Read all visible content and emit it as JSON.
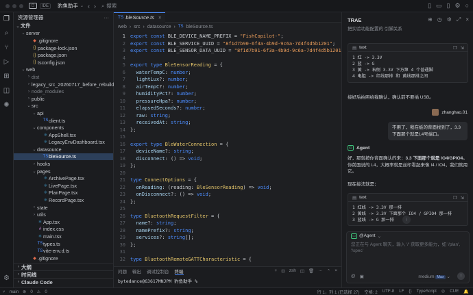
{
  "titlebar": {
    "app_badge": "IDE",
    "project": "豹鱼助手",
    "search_placeholder": "搜索"
  },
  "sidebar": {
    "title": "资源管理器",
    "rows": [
      {
        "d": 0,
        "tw": "⌄",
        "icon": "",
        "label": "文件",
        "kind": "section"
      },
      {
        "d": 1,
        "tw": "⌄",
        "icon": "",
        "label": "server",
        "kind": "folder"
      },
      {
        "d": 2,
        "tw": "",
        "icon": "◆",
        "label": ".gitignore",
        "kind": "git"
      },
      {
        "d": 2,
        "tw": "",
        "icon": "{}",
        "label": "package-lock.json",
        "kind": "json"
      },
      {
        "d": 2,
        "tw": "",
        "icon": "{}",
        "label": "package.json",
        "kind": "json"
      },
      {
        "d": 2,
        "tw": "",
        "icon": "{}",
        "label": "tsconfig.json",
        "kind": "json"
      },
      {
        "d": 1,
        "tw": "⌄",
        "icon": "",
        "label": "web",
        "kind": "folder"
      },
      {
        "d": 2,
        "tw": "›",
        "icon": "",
        "label": "dist",
        "kind": "folder-dim"
      },
      {
        "d": 2,
        "tw": "›",
        "icon": "",
        "label": "legacy_src_20260717_before_rebuild",
        "kind": "folder"
      },
      {
        "d": 2,
        "tw": "›",
        "icon": "",
        "label": "node_modules",
        "kind": "folder-dim"
      },
      {
        "d": 2,
        "tw": "›",
        "icon": "",
        "label": "public",
        "kind": "folder"
      },
      {
        "d": 2,
        "tw": "⌄",
        "icon": "",
        "label": "src",
        "kind": "folder"
      },
      {
        "d": 3,
        "tw": "⌄",
        "icon": "",
        "label": "api",
        "kind": "folder"
      },
      {
        "d": 4,
        "tw": "",
        "icon": "TS",
        "label": "client.ts",
        "kind": "ts"
      },
      {
        "d": 3,
        "tw": "⌄",
        "icon": "",
        "label": "components",
        "kind": "folder"
      },
      {
        "d": 4,
        "tw": "",
        "icon": "⚛",
        "label": "AppShell.tsx",
        "kind": "tsx"
      },
      {
        "d": 4,
        "tw": "",
        "icon": "⚛",
        "label": "LegacyEnvDashboard.tsx",
        "kind": "tsx"
      },
      {
        "d": 3,
        "tw": "⌄",
        "icon": "",
        "label": "datasource",
        "kind": "folder"
      },
      {
        "d": 4,
        "tw": "",
        "icon": "TS",
        "label": "bleSource.ts",
        "kind": "ts",
        "selected": true
      },
      {
        "d": 3,
        "tw": "›",
        "icon": "",
        "label": "hooks",
        "kind": "folder"
      },
      {
        "d": 3,
        "tw": "⌄",
        "icon": "",
        "label": "pages",
        "kind": "folder"
      },
      {
        "d": 4,
        "tw": "",
        "icon": "⚛",
        "label": "ArchivePage.tsx",
        "kind": "tsx"
      },
      {
        "d": 4,
        "tw": "",
        "icon": "⚛",
        "label": "LivePage.tsx",
        "kind": "tsx"
      },
      {
        "d": 4,
        "tw": "",
        "icon": "⚛",
        "label": "PlanPage.tsx",
        "kind": "tsx"
      },
      {
        "d": 4,
        "tw": "",
        "icon": "⚛",
        "label": "RecordPage.tsx",
        "kind": "tsx"
      },
      {
        "d": 3,
        "tw": "›",
        "icon": "",
        "label": "state",
        "kind": "folder"
      },
      {
        "d": 3,
        "tw": "›",
        "icon": "",
        "label": "utils",
        "kind": "folder"
      },
      {
        "d": 3,
        "tw": "",
        "icon": "⚛",
        "label": "App.tsx",
        "kind": "tsx"
      },
      {
        "d": 3,
        "tw": "",
        "icon": "#",
        "label": "index.css",
        "kind": "css"
      },
      {
        "d": 3,
        "tw": "",
        "icon": "⚛",
        "label": "main.tsx",
        "kind": "tsx"
      },
      {
        "d": 3,
        "tw": "",
        "icon": "TS",
        "label": "types.ts",
        "kind": "ts"
      },
      {
        "d": 3,
        "tw": "",
        "icon": "TS",
        "label": "vite-env.d.ts",
        "kind": "ts"
      },
      {
        "d": 2,
        "tw": "",
        "icon": "◆",
        "label": ".gitignore",
        "kind": "git"
      }
    ],
    "sections": [
      "大纲",
      "时间线",
      "Claude Code"
    ]
  },
  "editor": {
    "tab_icon": "TS",
    "tab_label": "bleSource.ts",
    "breadcrumb": [
      "web",
      "src",
      "datasource",
      "bleSource.ts"
    ],
    "lines": [
      [
        [
          "kw",
          "export"
        ],
        [
          "vr",
          " "
        ],
        [
          "kw",
          "const"
        ],
        [
          "vr",
          " BLE_DEVICE_NAME_PREFIX = "
        ],
        [
          "st",
          "\"FishCopilot-\""
        ],
        [
          "vr",
          ";"
        ]
      ],
      [
        [
          "kw",
          "export"
        ],
        [
          "vr",
          " "
        ],
        [
          "kw",
          "const"
        ],
        [
          "vr",
          " BLE_SERVICE_UUID = "
        ],
        [
          "st",
          "\"8f1d7b90-6f3a-4b9d-9c6a-7d4f4d5b1201\""
        ],
        [
          "vr",
          ";"
        ]
      ],
      [
        [
          "kw",
          "export"
        ],
        [
          "vr",
          " "
        ],
        [
          "kw",
          "const"
        ],
        [
          "vr",
          " BLE_SENSOR_DATA_UUID = "
        ],
        [
          "st",
          "\"8f1d7b91-6f3a-4b9d-9c6a-7d4f4d5b1201\""
        ],
        [
          "vr",
          ";"
        ]
      ],
      [],
      [
        [
          "kw",
          "export"
        ],
        [
          "vr",
          " "
        ],
        [
          "kw",
          "type"
        ],
        [
          "vr",
          " "
        ],
        [
          "tp",
          "BleSensorReading"
        ],
        [
          "vr",
          " = {"
        ]
      ],
      [
        [
          "vr",
          "  "
        ],
        [
          "pr",
          "waterTempC"
        ],
        [
          "vr",
          ": "
        ],
        [
          "kw",
          "number"
        ],
        [
          "vr",
          ";"
        ]
      ],
      [
        [
          "vr",
          "  "
        ],
        [
          "pr",
          "lightLux"
        ],
        [
          "vr",
          "?: "
        ],
        [
          "kw",
          "number"
        ],
        [
          "vr",
          ";"
        ]
      ],
      [
        [
          "vr",
          "  "
        ],
        [
          "pr",
          "airTempC"
        ],
        [
          "vr",
          "?: "
        ],
        [
          "kw",
          "number"
        ],
        [
          "vr",
          ";"
        ]
      ],
      [
        [
          "vr",
          "  "
        ],
        [
          "pr",
          "humidityPct"
        ],
        [
          "vr",
          "?: "
        ],
        [
          "kw",
          "number"
        ],
        [
          "vr",
          ";"
        ]
      ],
      [
        [
          "vr",
          "  "
        ],
        [
          "pr",
          "pressureHpa"
        ],
        [
          "vr",
          "?: "
        ],
        [
          "kw",
          "number"
        ],
        [
          "vr",
          ";"
        ]
      ],
      [
        [
          "vr",
          "  "
        ],
        [
          "pr",
          "elapsedSeconds"
        ],
        [
          "vr",
          "?: "
        ],
        [
          "kw",
          "number"
        ],
        [
          "vr",
          ";"
        ]
      ],
      [
        [
          "vr",
          "  "
        ],
        [
          "pr",
          "raw"
        ],
        [
          "vr",
          ": "
        ],
        [
          "kw",
          "string"
        ],
        [
          "vr",
          ";"
        ]
      ],
      [
        [
          "vr",
          "  "
        ],
        [
          "pr",
          "receivedAt"
        ],
        [
          "vr",
          ": "
        ],
        [
          "kw",
          "string"
        ],
        [
          "vr",
          ";"
        ]
      ],
      [
        [
          "vr",
          "};"
        ]
      ],
      [],
      [
        [
          "kw",
          "export"
        ],
        [
          "vr",
          " "
        ],
        [
          "kw",
          "type"
        ],
        [
          "vr",
          " "
        ],
        [
          "tp",
          "BleWaterConnection"
        ],
        [
          "vr",
          " = {"
        ]
      ],
      [
        [
          "vr",
          "  "
        ],
        [
          "pr",
          "deviceName"
        ],
        [
          "vr",
          "?: "
        ],
        [
          "kw",
          "string"
        ],
        [
          "vr",
          ";"
        ]
      ],
      [
        [
          "vr",
          "  "
        ],
        [
          "pr",
          "disconnect"
        ],
        [
          "vr",
          ": () => "
        ],
        [
          "kw",
          "void"
        ],
        [
          "vr",
          ";"
        ]
      ],
      [
        [
          "vr",
          "};"
        ]
      ],
      [],
      [
        [
          "kw",
          "type"
        ],
        [
          "vr",
          " "
        ],
        [
          "tp",
          "ConnectOptions"
        ],
        [
          "vr",
          " = {"
        ]
      ],
      [
        [
          "vr",
          "  "
        ],
        [
          "pr",
          "onReading"
        ],
        [
          "vr",
          ": (reading: "
        ],
        [
          "tp",
          "BleSensorReading"
        ],
        [
          "vr",
          ") => "
        ],
        [
          "kw",
          "void"
        ],
        [
          "vr",
          ";"
        ]
      ],
      [
        [
          "vr",
          "  "
        ],
        [
          "pr",
          "onDisconnect"
        ],
        [
          "vr",
          "?: () => "
        ],
        [
          "kw",
          "void"
        ],
        [
          "vr",
          ";"
        ]
      ],
      [
        [
          "vr",
          "};"
        ]
      ],
      [],
      [
        [
          "kw",
          "type"
        ],
        [
          "vr",
          " "
        ],
        [
          "tp",
          "BluetoothRequestFilter"
        ],
        [
          "vr",
          " = {"
        ]
      ],
      [
        [
          "vr",
          "  "
        ],
        [
          "pr",
          "name"
        ],
        [
          "vr",
          "?: "
        ],
        [
          "kw",
          "string"
        ],
        [
          "vr",
          ";"
        ]
      ],
      [
        [
          "vr",
          "  "
        ],
        [
          "pr",
          "namePrefix"
        ],
        [
          "vr",
          "?: "
        ],
        [
          "kw",
          "string"
        ],
        [
          "vr",
          ";"
        ]
      ],
      [
        [
          "vr",
          "  "
        ],
        [
          "pr",
          "services"
        ],
        [
          "vr",
          "?: "
        ],
        [
          "kw",
          "string"
        ],
        [
          "vr",
          "[];"
        ]
      ],
      [
        [
          "vr",
          "};"
        ]
      ],
      [],
      [
        [
          "kw",
          "type"
        ],
        [
          "vr",
          " "
        ],
        [
          "tp",
          "BluetoothRemoteGATTCharacteristic"
        ],
        [
          "vr",
          " = {"
        ]
      ]
    ],
    "current_line": 1
  },
  "panel": {
    "tabs": [
      "问题",
      "输出",
      "调试控制台",
      "终端"
    ],
    "active_tab": 3,
    "shell": "zsh",
    "prompt": "bytedance@63617MNJPM 豹鱼助手 %"
  },
  "chat": {
    "title": "TRAE",
    "top_text": "把实验功能配置的 引脚关系",
    "box1": {
      "lang": "text",
      "lines": [
        "1 红 -> 3.3V",
        "2 蓝 -> G",
        "3 黄 -> 右侧 3.3V 下方第 4 个普通脚",
        "4 电阻 -> 红线那排 和 黄线那排之间"
      ]
    },
    "para1": "接好后拍照给我确认，确认前不要插 USB。",
    "user_name": "zhanghao.01",
    "user_msg": "不用了，我在板的背面找到了，3.3下面那个就是L4号端口。",
    "agent_label": "Agent",
    "agent_p1_a": "好，那就按你背面确认的来：",
    "agent_p1_b": "3.3 下面那个就是 IO4/GPIO4",
    "agent_p1_c": "。你前面说的 L4，大概率就是丝印看起来像 I4 / IO4，我们就用它。",
    "para2": "现在接法就是：",
    "box2": {
      "lang": "text",
      "lines": [
        "1 红线 -> 3.3V 那一排",
        "2 黄线 -> 3.3V 下面那个 IO4 / GPIO4 那一排",
        "3 蓝线 -> G 那一排"
      ]
    },
    "input_label": "@Agent",
    "input_placeholder": "您正在与 Agent 聊天，输入 '/' 获取更多能力，如 '/plan', '/spec'",
    "model": "medium",
    "model_badge": "Max"
  },
  "status": {
    "branch": "main",
    "errors": "0",
    "warnings": "0",
    "position": "行 1，列 1 (已选择 27)",
    "spaces": "空格: 2",
    "encoding": "UTF-8",
    "eol": "LF",
    "lang": "TypeScript",
    "ime": "CUE"
  },
  "colors": {
    "accent": "#4c8dff",
    "keyword": "#4c8dff",
    "string": "#e79b5a",
    "type": "#e3c46a",
    "selection": "#2c3f5a"
  }
}
